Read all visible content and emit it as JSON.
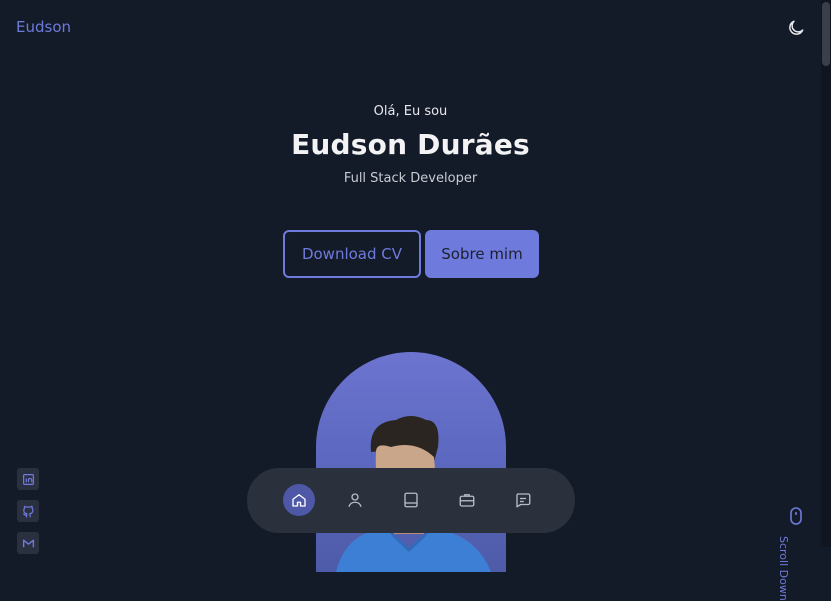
{
  "header": {
    "logo": "Eudson",
    "theme_icon": "moon-icon"
  },
  "hero": {
    "greeting": "Olá, Eu sou",
    "name": "Eudson Durães",
    "role": "Full Stack Developer",
    "download_label": "Download CV",
    "about_label": "Sobre mim"
  },
  "social": [
    {
      "icon": "linkedin-icon"
    },
    {
      "icon": "github-icon"
    },
    {
      "icon": "gmail-icon"
    }
  ],
  "nav": [
    {
      "icon": "home-icon",
      "active": true
    },
    {
      "icon": "user-icon",
      "active": false
    },
    {
      "icon": "book-icon",
      "active": false
    },
    {
      "icon": "briefcase-icon",
      "active": false
    },
    {
      "icon": "message-icon",
      "active": false
    }
  ],
  "scroll": {
    "icon": "mouse-icon",
    "label": "Scroll Down"
  },
  "colors": {
    "background": "#131a28",
    "accent": "#6f7bdc",
    "nav_bg": "#2a303c"
  }
}
